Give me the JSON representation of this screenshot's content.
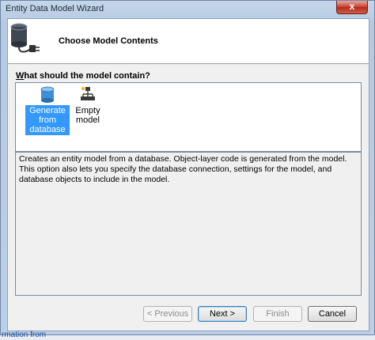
{
  "window": {
    "title": "Entity Data Model Wizard",
    "close_label": "x"
  },
  "header": {
    "title": "Choose Model Contents",
    "icon": "database-connector-icon"
  },
  "prompt": {
    "accel": "W",
    "rest": "hat should the model contain?"
  },
  "model_items": [
    {
      "label": "Generate from database",
      "icon": "database-icon",
      "selected": true
    },
    {
      "label": "Empty model",
      "icon": "model-hierarchy-icon",
      "selected": false
    }
  ],
  "description": "Creates an entity model from a database. Object-layer code is generated from the model. This option also lets you specify the database connection, settings for the model, and database objects to include in the model.",
  "buttons": {
    "previous": "< Previous",
    "next": "Next >",
    "finish": "Finish",
    "cancel": "Cancel"
  },
  "background_text": "rmation from"
}
